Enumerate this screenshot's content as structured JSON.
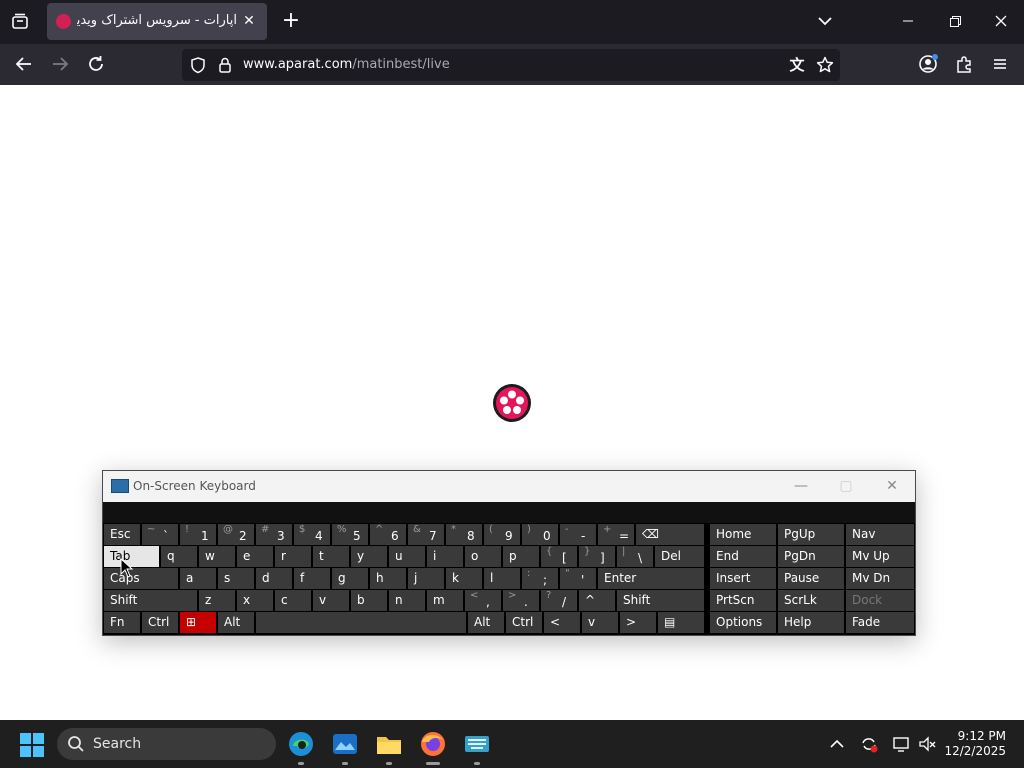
{
  "browser": {
    "tab_title": "آپارات - سرویس اشتراک ویدیو",
    "url_host": "www.aparat.com",
    "url_path": "/matinbest/live"
  },
  "osk": {
    "title": "On-Screen Keyboard",
    "rows": [
      [
        {
          "label": "Esc"
        },
        {
          "sec": "~",
          "pri": "`"
        },
        {
          "sec": "!",
          "pri": "1"
        },
        {
          "sec": "@",
          "pri": "2"
        },
        {
          "sec": "#",
          "pri": "3"
        },
        {
          "sec": "$",
          "pri": "4"
        },
        {
          "sec": "%",
          "pri": "5"
        },
        {
          "sec": "^",
          "pri": "6"
        },
        {
          "sec": "&",
          "pri": "7"
        },
        {
          "sec": "*",
          "pri": "8"
        },
        {
          "sec": "(",
          "pri": "9"
        },
        {
          "sec": ")",
          "pri": "0"
        },
        {
          "sec": "-",
          "pri": "-"
        },
        {
          "sec": "+",
          "pri": "="
        },
        {
          "label": "⌫"
        }
      ],
      [
        {
          "label": "Tab"
        },
        {
          "label": "q"
        },
        {
          "label": "w"
        },
        {
          "label": "e"
        },
        {
          "label": "r"
        },
        {
          "label": "t"
        },
        {
          "label": "y"
        },
        {
          "label": "u"
        },
        {
          "label": "i"
        },
        {
          "label": "o"
        },
        {
          "label": "p"
        },
        {
          "sec": "{",
          "pri": "["
        },
        {
          "sec": "}",
          "pri": "]"
        },
        {
          "sec": "|",
          "pri": "\\"
        },
        {
          "label": "Del"
        }
      ],
      [
        {
          "label": "Caps"
        },
        {
          "label": "a"
        },
        {
          "label": "s"
        },
        {
          "label": "d"
        },
        {
          "label": "f"
        },
        {
          "label": "g"
        },
        {
          "label": "h"
        },
        {
          "label": "j"
        },
        {
          "label": "k"
        },
        {
          "label": "l"
        },
        {
          "sec": ":",
          "pri": ";"
        },
        {
          "sec": "\"",
          "pri": "'"
        },
        {
          "label": "Enter"
        }
      ],
      [
        {
          "label": "Shift"
        },
        {
          "label": "z"
        },
        {
          "label": "x"
        },
        {
          "label": "c"
        },
        {
          "label": "v"
        },
        {
          "label": "b"
        },
        {
          "label": "n"
        },
        {
          "label": "m"
        },
        {
          "sec": "<",
          "pri": ","
        },
        {
          "sec": ">",
          "pri": "."
        },
        {
          "sec": "?",
          "pri": "/"
        },
        {
          "label": "^"
        },
        {
          "label": "Shift"
        }
      ],
      [
        {
          "label": "Fn"
        },
        {
          "label": "Ctrl"
        },
        {
          "label": "⊞"
        },
        {
          "label": "Alt"
        },
        {
          "label": ""
        },
        {
          "label": "Alt"
        },
        {
          "label": "Ctrl"
        },
        {
          "label": "<"
        },
        {
          "label": "v"
        },
        {
          "label": ">"
        },
        {
          "label": "▤"
        }
      ]
    ],
    "right_keys": [
      [
        "Home",
        "PgUp",
        "Nav"
      ],
      [
        "End",
        "PgDn",
        "Mv Up"
      ],
      [
        "Insert",
        "Pause",
        "Mv Dn"
      ],
      [
        "PrtScn",
        "ScrLk",
        "Dock"
      ],
      [
        "Options",
        "Help",
        "Fade"
      ]
    ]
  },
  "taskbar": {
    "search_label": "Search",
    "time": "9:12 PM",
    "date": "12/2/2025"
  }
}
